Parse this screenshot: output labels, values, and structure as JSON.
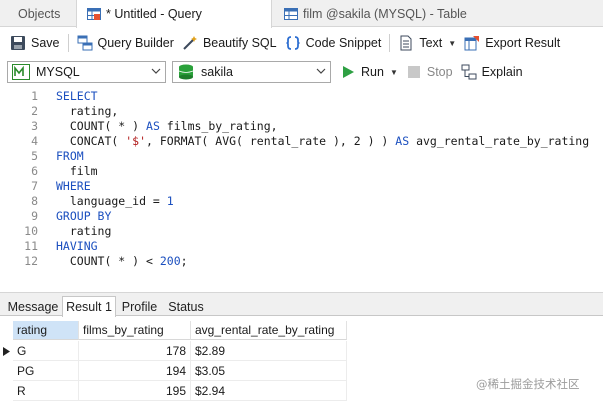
{
  "tabs": [
    {
      "label": "Objects"
    },
    {
      "label": "* Untitled - Query"
    },
    {
      "label": "film @sakila (MYSQL) - Table"
    }
  ],
  "toolbar": {
    "save": "Save",
    "query_builder": "Query Builder",
    "beautify_sql": "Beautify SQL",
    "code_snippet": "Code Snippet",
    "text": "Text",
    "export_result": "Export Result"
  },
  "connection": {
    "server": "MYSQL",
    "database": "sakila",
    "run": "Run",
    "stop": "Stop",
    "explain": "Explain"
  },
  "editor": {
    "line_numbers": [
      "1",
      "2",
      "3",
      "4",
      "5",
      "6",
      "7",
      "8",
      "9",
      "10",
      "11",
      "12"
    ],
    "lines": [
      "SELECT",
      "  rating,",
      "  COUNT( * ) AS films_by_rating,",
      "  CONCAT( '$', FORMAT( AVG( rental_rate ), 2 ) ) AS avg_rental_rate_by_rating",
      "FROM",
      "  film",
      "WHERE",
      "  language_id = 1",
      "GROUP BY",
      "  rating",
      "HAVING",
      "  COUNT( * ) < 200;"
    ]
  },
  "result_tabs": [
    {
      "label": "Message"
    },
    {
      "label": "Result 1"
    },
    {
      "label": "Profile"
    },
    {
      "label": "Status"
    }
  ],
  "result": {
    "columns": [
      "rating",
      "films_by_rating",
      "avg_rental_rate_by_rating"
    ],
    "rows": [
      [
        "G",
        "178",
        "$2.89"
      ],
      [
        "PG",
        "194",
        "$3.05"
      ],
      [
        "R",
        "195",
        "$2.94"
      ]
    ]
  },
  "watermark": "@稀土掘金技术社区",
  "colors": {
    "keyword": "#1b4fbf",
    "string": "#b11a1a",
    "selected_header": "#cfe3f7",
    "run_green": "#2ea043"
  }
}
